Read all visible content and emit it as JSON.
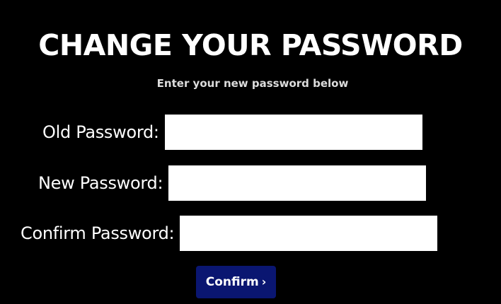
{
  "page": {
    "title": "CHANGE YOUR PASSWORD",
    "subtitle": "Enter your new password below"
  },
  "form": {
    "fields": [
      {
        "label": "Old Password:",
        "value": "",
        "placeholder": ""
      },
      {
        "label": "New Password:",
        "value": "",
        "placeholder": ""
      },
      {
        "label": "Confirm Password:",
        "value": "",
        "placeholder": ""
      }
    ],
    "submit_label": "Confirm",
    "submit_icon": "chevron-right-icon"
  },
  "colors": {
    "background": "#000000",
    "text": "#ffffff",
    "subtitle": "#dcdcdc",
    "button": "#0a1671"
  }
}
